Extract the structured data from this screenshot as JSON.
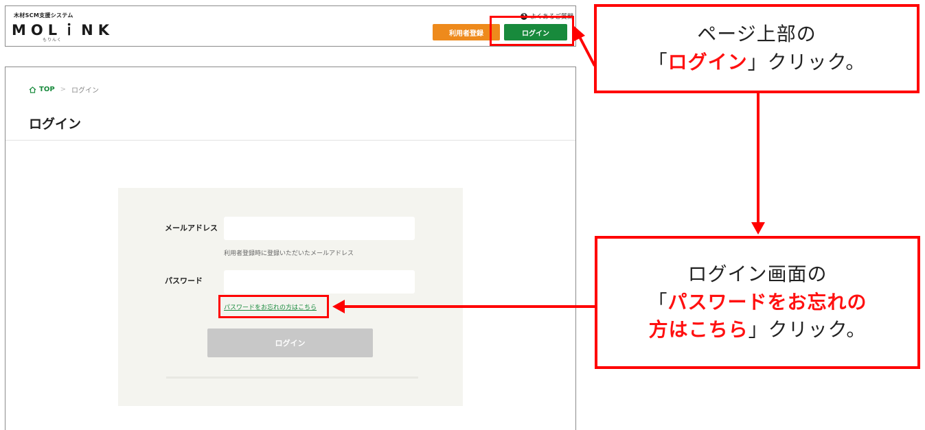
{
  "header": {
    "logo_tagline": "木材SCM支援システム",
    "logo_text": "MOLｉNK",
    "logo_reading": "もりんく",
    "faq_label": "よくあるご質問",
    "register_button": "利用者登録",
    "login_button": "ログイン"
  },
  "breadcrumb": {
    "home": "TOP",
    "separator": ">",
    "current": "ログイン"
  },
  "page_title": "ログイン",
  "form": {
    "email_label": "メールアドレス",
    "email_value": "",
    "email_hint": "利用者登録時に登録いただいたメールアドレス",
    "password_label": "パスワード",
    "password_value": "",
    "forgot_link": "パスワードをお忘れの方はこちら",
    "submit_button": "ログイン"
  },
  "annotations": {
    "step1": {
      "line1": "ページ上部の",
      "open_quote": "「",
      "target": "ログイン",
      "close": "」クリック。"
    },
    "step2": {
      "line1": "ログイン画面の",
      "open_quote": "「",
      "target_a": "パスワードをお忘れの",
      "target_b": "方はこちら",
      "close": "」クリック。"
    }
  },
  "colors": {
    "annotation_red": "#ff0000",
    "brand_green": "#188a3c",
    "register_orange": "#ee8a1c",
    "disabled_gray": "#c8c8c8"
  }
}
